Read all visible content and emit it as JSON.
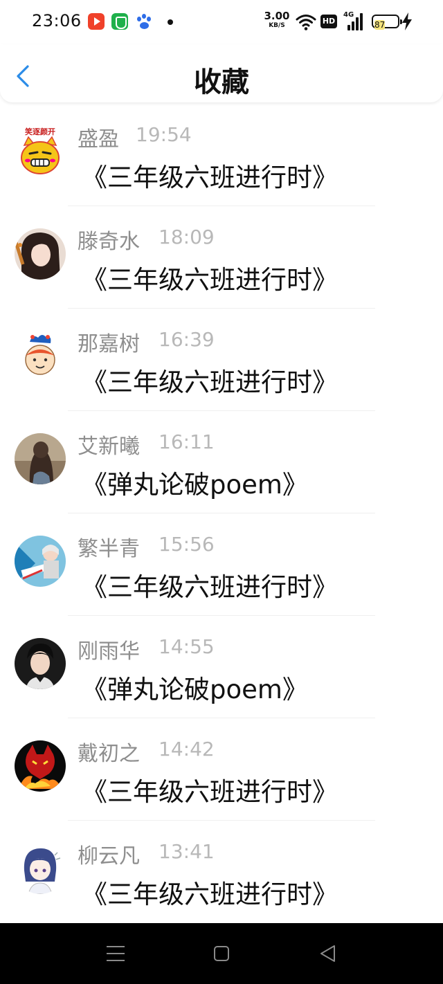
{
  "status_bar": {
    "time": "23:06",
    "net_speed_value": "3.00",
    "net_speed_unit": "KB/S",
    "hd_label": "HD",
    "signal_label": "4G",
    "battery_level": "87"
  },
  "header": {
    "title": "收藏"
  },
  "favorites": [
    {
      "name": "盛盈",
      "time": "19:54",
      "title": "《三年级六班进行时》"
    },
    {
      "name": "滕奇水",
      "time": "18:09",
      "title": "《三年级六班进行时》"
    },
    {
      "name": "那嘉树",
      "time": "16:39",
      "title": "《三年级六班进行时》"
    },
    {
      "name": "艾新曦",
      "time": "16:11",
      "title": "《弹丸论破poem》"
    },
    {
      "name": "繁半青",
      "time": "15:56",
      "title": "《三年级六班进行时》"
    },
    {
      "name": "刚雨华",
      "time": "14:55",
      "title": "《弹丸论破poem》"
    },
    {
      "name": "戴初之",
      "time": "14:42",
      "title": "《三年级六班进行时》"
    },
    {
      "name": "柳云凡",
      "time": "13:41",
      "title": "《三年级六班进行时》"
    }
  ],
  "avatar_texts": {
    "cat_caption": "笑逐颜开"
  },
  "colors": {
    "accent_back": "#2b8ce8",
    "name_gray": "#8e8e8e",
    "time_gray": "#b8b8b8"
  }
}
